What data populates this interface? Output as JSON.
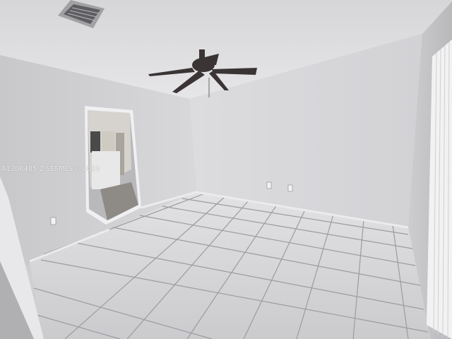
{
  "photo": {
    "watermark": "A1206485 2 SEFMLS® 2023",
    "colors": {
      "ceiling": "#e4e4e6",
      "back_wall": "#d9d9dc",
      "left_wall": "#d2d2d5",
      "right_wall": "#c9c9cc",
      "floor_tile": "#d6d6d8",
      "grout": "#9c9ca0",
      "fan": "#3a3434",
      "vent": "#8d8d90",
      "blinds": "#f2f2f2"
    }
  }
}
